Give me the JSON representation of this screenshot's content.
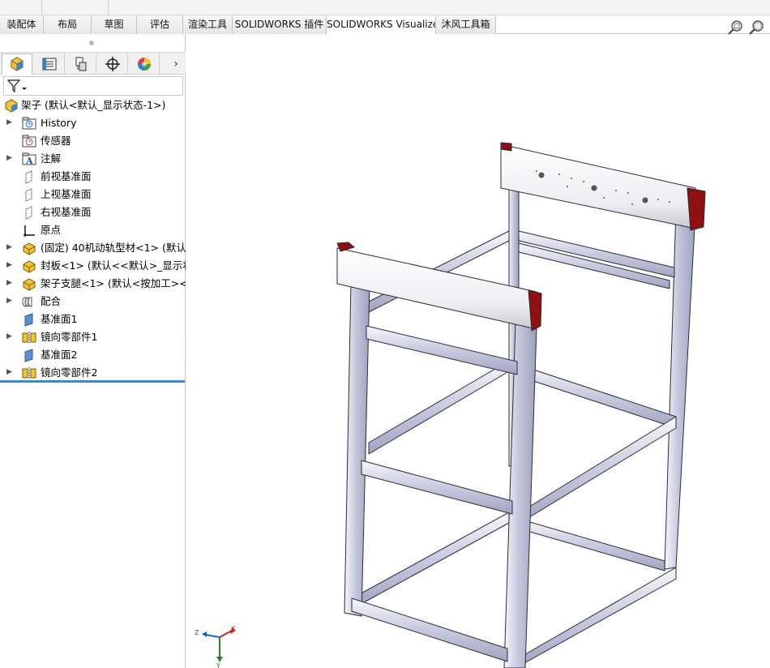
{
  "ribbon": {
    "tabs": [
      {
        "label": "装配体"
      },
      {
        "label": "布局"
      },
      {
        "label": "草图"
      },
      {
        "label": "评估"
      },
      {
        "label": "渲染工具"
      },
      {
        "label": "SOLIDWORKS 插件"
      },
      {
        "label": "SOLIDWORKS Visualize"
      },
      {
        "label": "沐风工具箱"
      }
    ],
    "active_tab_index": 6
  },
  "view_tools": [
    {
      "icon": "zoom-to-fit-icon"
    },
    {
      "icon": "zoom-to-area-icon"
    }
  ],
  "panel": {
    "icon_tabs": [
      {
        "icon": "feature-manager-icon"
      },
      {
        "icon": "property-manager-icon"
      },
      {
        "icon": "configuration-manager-icon"
      },
      {
        "icon": "dimxpert-manager-icon"
      },
      {
        "icon": "display-manager-icon"
      }
    ],
    "more_arrow": "›",
    "filter_icon": "filter-icon"
  },
  "tree": {
    "root": {
      "label": "架子  (默认<默认_显示状态-1>)",
      "icon": "assembly-icon"
    },
    "items": [
      {
        "label": "History",
        "icon": "history-folder-icon",
        "expandable": true
      },
      {
        "label": "传感器",
        "icon": "sensor-icon",
        "expandable": false
      },
      {
        "label": "注解",
        "icon": "annotation-icon",
        "expandable": true
      },
      {
        "label": "前视基准面",
        "icon": "plane-icon",
        "expandable": false
      },
      {
        "label": "上视基准面",
        "icon": "plane-icon",
        "expandable": false
      },
      {
        "label": "右视基准面",
        "icon": "plane-icon",
        "expandable": false
      },
      {
        "label": "原点",
        "icon": "origin-icon",
        "expandable": false
      },
      {
        "label": "(固定) 40机动轨型材<1> (默认<",
        "icon": "part-icon",
        "expandable": true
      },
      {
        "label": "封板<1> (默认<<默认>_显示状态",
        "icon": "part-icon",
        "expandable": true
      },
      {
        "label": "架子支腿<1> (默认<按加工><<",
        "icon": "part-icon",
        "expandable": true
      },
      {
        "label": "配合",
        "icon": "mates-icon",
        "expandable": true
      },
      {
        "label": "基准面1",
        "icon": "ref-plane-icon",
        "expandable": false
      },
      {
        "label": "镜向零部件1",
        "icon": "mirror-component-icon",
        "expandable": true
      },
      {
        "label": "基准面2",
        "icon": "ref-plane-icon",
        "expandable": false
      },
      {
        "label": "镜向零部件2",
        "icon": "mirror-component-icon",
        "expandable": true
      }
    ]
  },
  "triad": {
    "x": "X",
    "y": "Y",
    "z": "Z"
  },
  "colors": {
    "frame_profile": "#c9cbe0",
    "frame_outline": "#2b2b3a",
    "end_cap": "#8f1010",
    "tree_end_bar": "#2f8fd0",
    "tab_border": "#c6c6c6"
  }
}
